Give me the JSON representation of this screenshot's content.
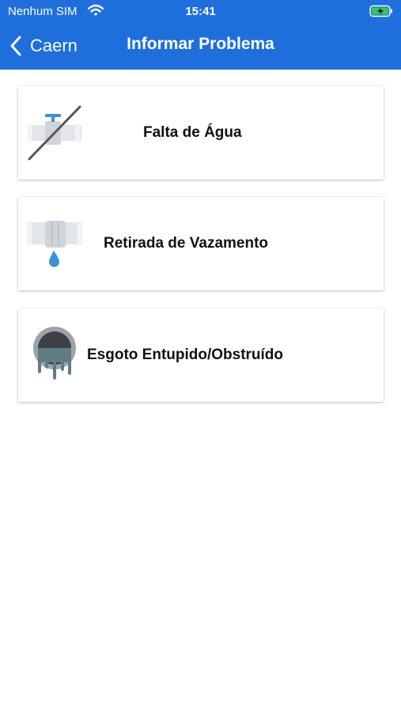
{
  "status_bar": {
    "carrier": "Nenhum SIM",
    "time": "15:41"
  },
  "nav": {
    "back_label": "Caern",
    "title": "Informar Problema"
  },
  "colors": {
    "accent": "#1e6fdc"
  },
  "options": [
    {
      "label": "Falta de Água",
      "icon": "no-water-faucet-icon"
    },
    {
      "label": "Retirada de Vazamento",
      "icon": "leaking-pipe-icon"
    },
    {
      "label": "Esgoto Entupido/Obstruído",
      "icon": "clogged-sewer-icon"
    }
  ]
}
